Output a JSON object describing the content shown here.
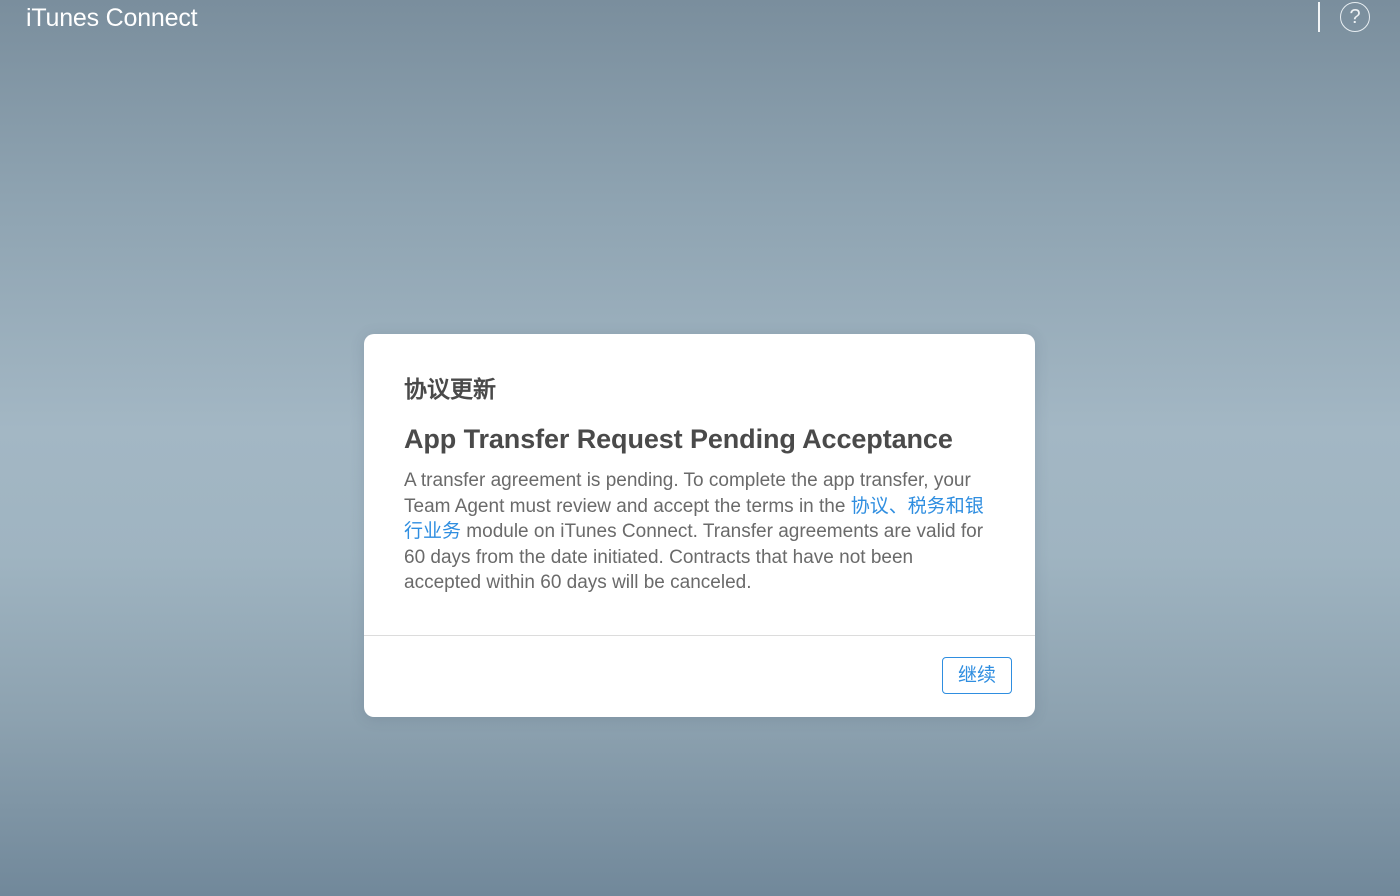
{
  "header": {
    "brand": "iTunes Connect",
    "help_icon": "help-icon",
    "help_glyph": "?"
  },
  "modal": {
    "kicker": "协议更新",
    "title": "App Transfer Request Pending Acceptance",
    "text_before_link": "A transfer agreement is pending. To complete the app transfer, your Team Agent must review and accept the terms in the ",
    "link_text": "协议、税务和银行业务",
    "text_after_link": " module on iTunes Connect. Transfer agreements are valid for 60 days from the date initiated. Contracts that have not been accepted within 60 days will be canceled.",
    "continue_label": "继续"
  },
  "colors": {
    "accent": "#2f8ee0",
    "heading": "#4a4a4a",
    "body_text": "#6a6a6a",
    "background_mid": "#a3b7c4"
  }
}
